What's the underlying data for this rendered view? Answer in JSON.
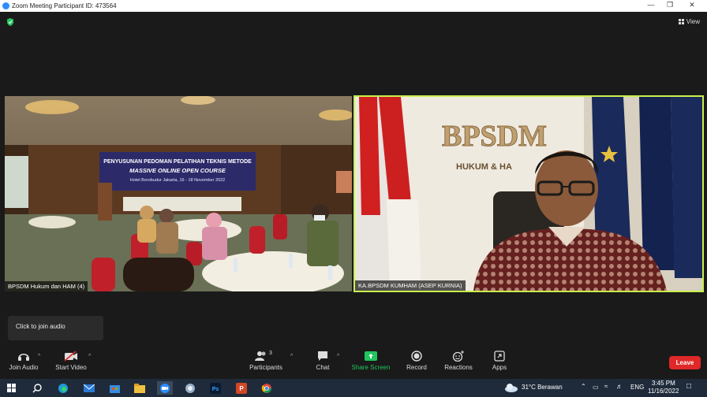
{
  "window": {
    "title": "Zoom Meeting Participant ID: 473564"
  },
  "header": {
    "view_label": "View"
  },
  "tiles": {
    "left": {
      "name": "BPSDM Hukum dan HAM (4)",
      "banner_line1": "PENYUSUNAN PEDOMAN PELATIHAN TEKNIS METODE",
      "banner_line2": "MASSIVE ONLINE OPEN COURSE",
      "banner_line3": "Hotel Borobudur Jakarta, 16 - 18 November 2022"
    },
    "right": {
      "name": "KA.BPSDM KUMHAM (ASEP KURNIA)",
      "wall_title": "BPSDM",
      "wall_subtitle": "HUKUM & HA"
    }
  },
  "tooltip": {
    "text": "Click to join audio"
  },
  "toolbar": {
    "join_audio": "Join Audio",
    "start_video": "Start Video",
    "participants": "Participants",
    "participants_count": "3",
    "chat": "Chat",
    "share_screen": "Share Screen",
    "record": "Record",
    "reactions": "Reactions",
    "apps": "Apps",
    "leave": "Leave"
  },
  "taskbar": {
    "weather": "31°C  Berawan",
    "language": "ENG",
    "time": "3:45 PM",
    "date": "11/16/2022"
  },
  "colors": {
    "active_speaker": "#c9f04b",
    "share_green": "#22c55e",
    "leave_red": "#e02828"
  }
}
